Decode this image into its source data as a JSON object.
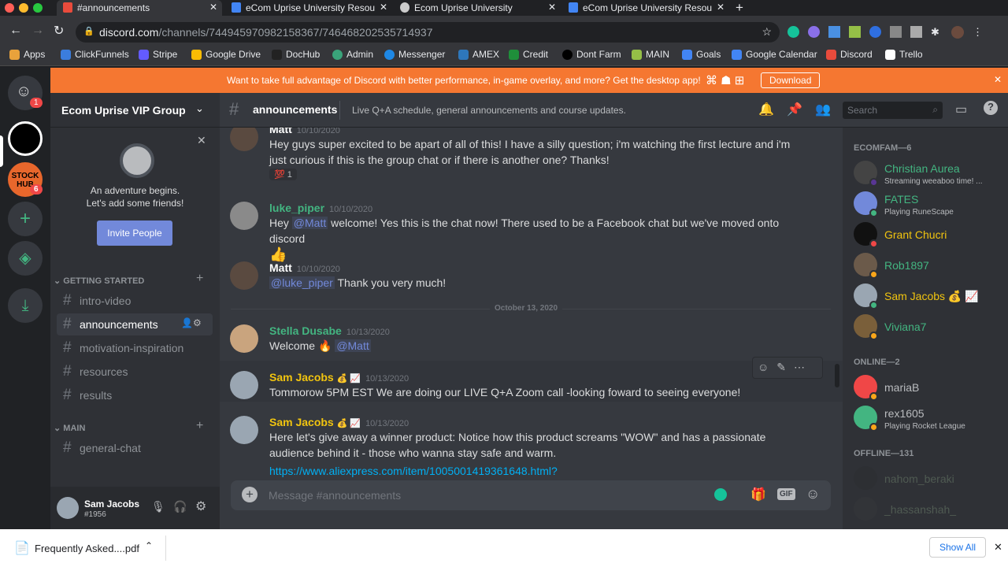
{
  "browser": {
    "tabs": [
      {
        "title": "#announcements"
      },
      {
        "title": "eCom Uprise University Resou"
      },
      {
        "title": "Ecom Uprise University"
      },
      {
        "title": "eCom Uprise University Resou"
      }
    ],
    "url_host": "discord.com",
    "url_path": "/channels/744945970982158367/746468202535714937",
    "bookmarks": [
      "Apps",
      "ClickFunnels",
      "Stripe",
      "Google Drive",
      "DocHub",
      "Admin",
      "Messenger",
      "AMEX",
      "Credit",
      "Dont Farm",
      "MAIN",
      "Goals",
      "Google Calendar",
      "Discord",
      "Trello"
    ]
  },
  "banner": {
    "text": "Want to take full advantage of Discord with better performance, in-game overlay, and more? Get the desktop app!",
    "button": "Download"
  },
  "servers": {
    "home_badge": "1",
    "stock_badge": "6",
    "stock_label": "STOCK HUB"
  },
  "sidebar": {
    "server_name": "Ecom Uprise VIP Group",
    "invite_text1": "An adventure begins.",
    "invite_text2": "Let's add some friends!",
    "invite_button": "Invite People",
    "categories": [
      {
        "name": "GETTING STARTED",
        "channels": [
          "intro-video",
          "announcements",
          "motivation-inspiration",
          "resources",
          "results"
        ]
      },
      {
        "name": "MAIN",
        "channels": [
          "general-chat"
        ]
      }
    ],
    "user": {
      "name": "Sam Jacobs",
      "tag": "#1956"
    }
  },
  "header": {
    "channel": "announcements",
    "topic": "Live Q+A schedule, general announcements and course updates.",
    "search_placeholder": "Search"
  },
  "messages": [
    {
      "author": "Matt",
      "time": "10/10/2020",
      "text": "Hey guys super excited to be apart of all of this! I have a silly question; i'm watching the first lecture and i'm just curious if this is the group chat or if there is another one? Thanks!",
      "reaction": "💯 1"
    },
    {
      "author": "luke_piper",
      "time": "10/10/2020",
      "pre": "Hey ",
      "mention": "@Matt",
      "text": " welcome! Yes this is the chat now! There used to be a Facebook chat but we've moved onto discord",
      "emoji": "👍"
    },
    {
      "author": "Matt",
      "time": "10/10/2020",
      "mention": "@luke_piper",
      "text": " Thank you very much!"
    },
    {
      "author": "Stella Dusabe",
      "time": "10/13/2020",
      "pre": "Welcome ",
      "emoji": "🔥",
      "mention": "@Matt"
    },
    {
      "author": "Sam Jacobs",
      "badges": "💰 📈",
      "time": "10/13/2020",
      "text": "Tommorow 5PM EST We are doing our LIVE Q+A Zoom call -looking foward to seeing everyone!"
    },
    {
      "author": "Sam Jacobs",
      "badges": "💰 📈",
      "time": "10/13/2020",
      "text": "Here let's give away a winner product: Notice how this product screams \"WOW\" and has a passionate audience behind it - those who wanna stay safe and warm.",
      "link": "https://www.aliexpress.com/item/1005001419361648.html?"
    }
  ],
  "divider": "October 13, 2020",
  "composer": {
    "placeholder": "Message #announcements",
    "gif": "GIF"
  },
  "members": {
    "groups": [
      {
        "title": "ECOMFAM—6",
        "items": [
          {
            "name": "Christian Aurea",
            "status": "Streaming weeaboo time! ...",
            "color": "#43b581"
          },
          {
            "name": "FATES",
            "status": "Playing RuneScape",
            "color": "#43b581"
          },
          {
            "name": "Grant Chucri",
            "color": "#f1c40f"
          },
          {
            "name": "Rob1897",
            "color": "#43b581"
          },
          {
            "name": "Sam Jacobs 💰 📈",
            "color": "#f1c40f"
          },
          {
            "name": "Viviana7",
            "color": "#43b581"
          }
        ]
      },
      {
        "title": "ONLINE—2",
        "items": [
          {
            "name": "mariaB",
            "color": "#b9bbbe"
          },
          {
            "name": "rex1605",
            "status": "Playing Rocket League",
            "color": "#b9bbbe"
          }
        ]
      },
      {
        "title": "OFFLINE—131",
        "items": [
          {
            "name": "nahom_beraki",
            "color": "#4f5a52"
          },
          {
            "name": "_hassanshah_",
            "color": "#4f5a52"
          }
        ]
      }
    ]
  },
  "downloads": {
    "file": "Frequently Asked....pdf",
    "show_all": "Show All"
  }
}
